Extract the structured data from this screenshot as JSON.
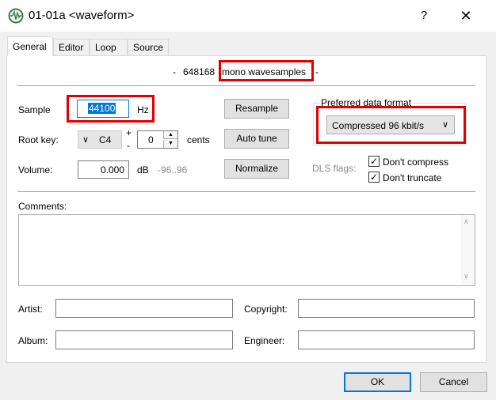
{
  "window": {
    "title": "01-01a <waveform>",
    "help_glyph": "?",
    "close_glyph": "✕"
  },
  "tabs": [
    {
      "label": "General"
    },
    {
      "label": "Editor"
    },
    {
      "label": "Loop"
    },
    {
      "label": "Source"
    }
  ],
  "info": {
    "dash_left": "-",
    "count": "648168",
    "type": "mono wavesamples",
    "dash_right": "-"
  },
  "sample": {
    "label": "Sample",
    "value": "44100",
    "unit": "Hz"
  },
  "root_key": {
    "label": "Root key:",
    "value": "C4",
    "plus": "+",
    "minus": "-",
    "cents_value": "0",
    "cents_label": "cents"
  },
  "volume": {
    "label": "Volume:",
    "value": "0.000",
    "unit": "dB",
    "range": "-96..96"
  },
  "buttons": {
    "resample": "Resample",
    "auto_tune": "Auto tune",
    "normalize": "Normalize",
    "ok": "OK",
    "cancel": "Cancel"
  },
  "preferred_format": {
    "label": "Preferred data format",
    "value": "Compressed 96 kbit/s"
  },
  "dls_flags": {
    "label": "DLS flags:",
    "dont_compress": {
      "label": "Don't compress",
      "checked": true
    },
    "dont_truncate": {
      "label": "Don't truncate",
      "checked": true
    }
  },
  "comments": {
    "label": "Comments:",
    "value": ""
  },
  "artist": {
    "label": "Artist:",
    "value": ""
  },
  "copyright": {
    "label": "Copyright:",
    "value": ""
  },
  "album": {
    "label": "Album:",
    "value": ""
  },
  "engineer": {
    "label": "Engineer:",
    "value": ""
  },
  "colors": {
    "highlight": "#e00000",
    "selection": "#0078d7",
    "ok_border": "#0078d7"
  }
}
